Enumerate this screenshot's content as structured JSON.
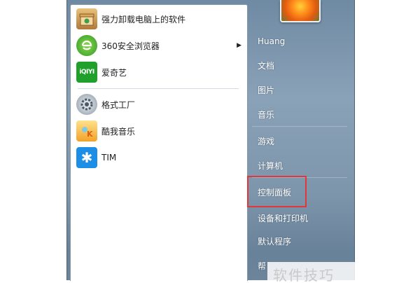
{
  "programs": [
    {
      "label": "强力卸载电脑上的软件",
      "icon": "uninstall-box-icon",
      "color": "#c89a5a"
    },
    {
      "label": "360安全浏览器",
      "icon": "360-browser-icon",
      "color": "#3fae3a",
      "has_submenu": true
    },
    {
      "label": "爱奇艺",
      "icon": "iqiyi-icon",
      "color": "#2fae1f"
    },
    {
      "label": "格式工厂",
      "icon": "format-factory-icon",
      "color": "#8a96a4"
    },
    {
      "label": "酷我音乐",
      "icon": "kuwo-music-icon",
      "color": "#f2b53a"
    },
    {
      "label": "TIM",
      "icon": "tim-icon",
      "color": "#1c8ee6"
    }
  ],
  "submenu_arrow": "▶",
  "user": {
    "name": "Huang",
    "avatar_icon": "flower-avatar-icon"
  },
  "right_items": [
    {
      "label": "文档"
    },
    {
      "label": "图片"
    },
    {
      "label": "音乐"
    },
    {
      "label": "游戏"
    },
    {
      "label": "计算机"
    },
    {
      "label": "控制面板",
      "highlighted": true
    },
    {
      "label": "设备和打印机"
    },
    {
      "label": "默认程序"
    },
    {
      "label": "帮"
    }
  ],
  "highlight_color": "#e0383a",
  "watermark": "软件技巧"
}
